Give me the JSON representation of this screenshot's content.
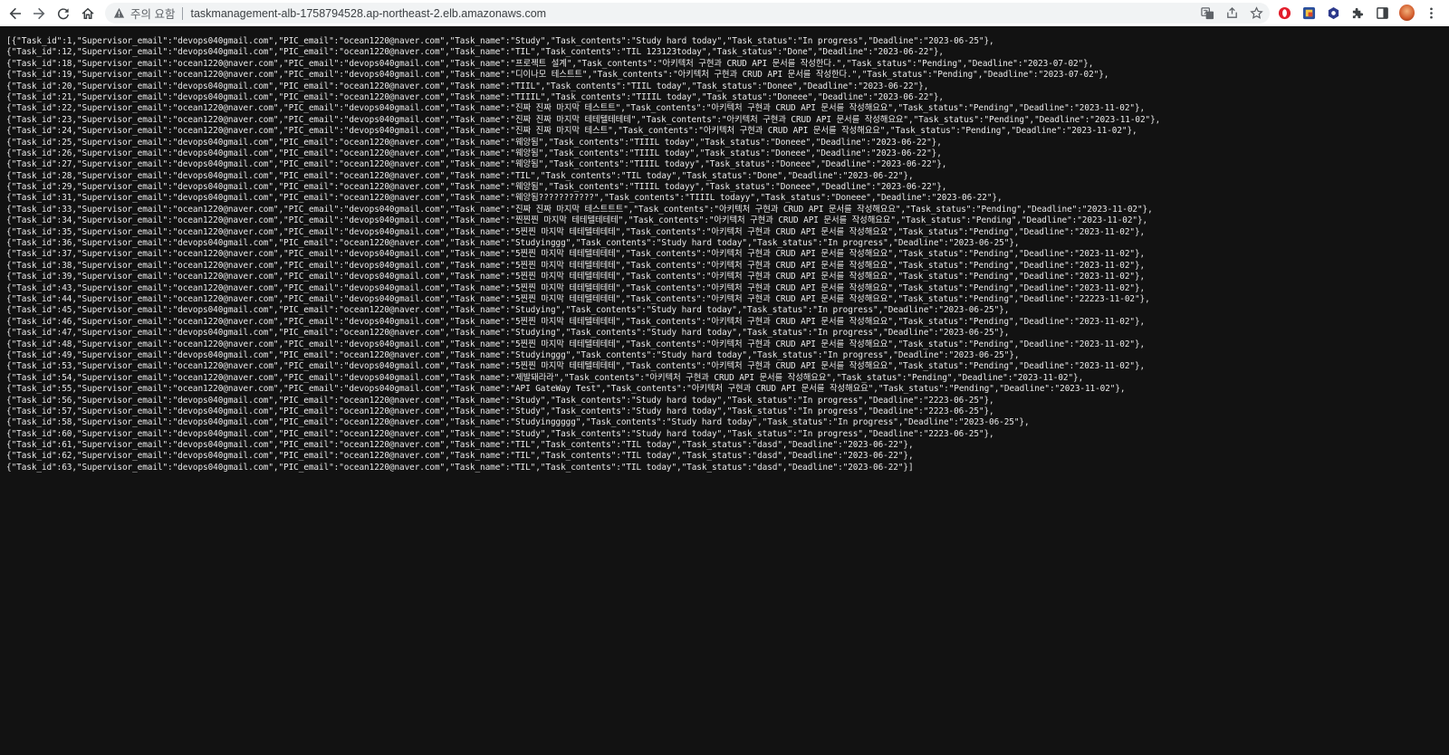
{
  "browser": {
    "security_label": "주의 요함",
    "url": "taskmanagement-alb-1758794528.ap-northeast-2.elb.amazonaws.com"
  },
  "response_lines": [
    "[{\"Task_id\":1,\"Supervisor_email\":\"devops040gmail.com\",\"PIC_email\":\"ocean1220@naver.com\",\"Task_name\":\"Study\",\"Task_contents\":\"Study hard today\",\"Task_status\":\"In progress\",\"Deadline\":\"2023-06-25\"},",
    "{\"Task_id\":12,\"Supervisor_email\":\"devops040gmail.com\",\"PIC_email\":\"ocean1220@naver.com\",\"Task_name\":\"TIL\",\"Task_contents\":\"TIL 123123today\",\"Task_status\":\"Done\",\"Deadline\":\"2023-06-22\"},",
    "{\"Task_id\":18,\"Supervisor_email\":\"ocean1220@naver.com\",\"PIC_email\":\"devops040gmail.com\",\"Task_name\":\"프로젝트 설계\",\"Task_contents\":\"아키텍처 구현과 CRUD API 문서를 작성한다.\",\"Task_status\":\"Pending\",\"Deadline\":\"2023-07-02\"},",
    "{\"Task_id\":19,\"Supervisor_email\":\"ocean1220@naver.com\",\"PIC_email\":\"devops040gmail.com\",\"Task_name\":\"디이나모 테스트트\",\"Task_contents\":\"아키텍처 구현과 CRUD API 문서를 작성한다.\",\"Task_status\":\"Pending\",\"Deadline\":\"2023-07-02\"},",
    "{\"Task_id\":20,\"Supervisor_email\":\"devops040gmail.com\",\"PIC_email\":\"ocean1220@naver.com\",\"Task_name\":\"TIIL\",\"Task_contents\":\"TIIL today\",\"Task_status\":\"Donee\",\"Deadline\":\"2023-06-22\"},",
    "{\"Task_id\":21,\"Supervisor_email\":\"devops040gmail.com\",\"PIC_email\":\"ocean1220@naver.com\",\"Task_name\":\"TIIIL\",\"Task_contents\":\"TIIIL today\",\"Task_status\":\"Doneee\",\"Deadline\":\"2023-06-22\"},",
    "{\"Task_id\":22,\"Supervisor_email\":\"ocean1220@naver.com\",\"PIC_email\":\"devops040gmail.com\",\"Task_name\":\"진짜 진짜 마지막 테스트트\",\"Task_contents\":\"아키텍처 구현과 CRUD API 문서를 작성해요요\",\"Task_status\":\"Pending\",\"Deadline\":\"2023-11-02\"},",
    "{\"Task_id\":23,\"Supervisor_email\":\"ocean1220@naver.com\",\"PIC_email\":\"devops040gmail.com\",\"Task_name\":\"진짜 진짜 마지막 테테텔테테테\",\"Task_contents\":\"아키텍처 구현과 CRUD API 문서를 작성해요요\",\"Task_status\":\"Pending\",\"Deadline\":\"2023-11-02\"},",
    "{\"Task_id\":24,\"Supervisor_email\":\"ocean1220@naver.com\",\"PIC_email\":\"devops040gmail.com\",\"Task_name\":\"진짜 진짜 마지막 테스트\",\"Task_contents\":\"아키텍처 구현과 CRUD API 문서를 작성해요요\",\"Task_status\":\"Pending\",\"Deadline\":\"2023-11-02\"},",
    "{\"Task_id\":25,\"Supervisor_email\":\"devops040gmail.com\",\"PIC_email\":\"ocean1220@naver.com\",\"Task_name\":\"웨앙됨\",\"Task_contents\":\"TIIIL today\",\"Task_status\":\"Doneee\",\"Deadline\":\"2023-06-22\"},",
    "{\"Task_id\":26,\"Supervisor_email\":\"devops040gmail.com\",\"PIC_email\":\"ocean1220@naver.com\",\"Task_name\":\"웨앙됨\",\"Task_contents\":\"TIIIL today\",\"Task_status\":\"Doneee\",\"Deadline\":\"2023-06-22\"},",
    "{\"Task_id\":27,\"Supervisor_email\":\"devops040gmail.com\",\"PIC_email\":\"ocean1220@naver.com\",\"Task_name\":\"웨앙됨\",\"Task_contents\":\"TIIIL todayy\",\"Task_status\":\"Doneee\",\"Deadline\":\"2023-06-22\"},",
    "{\"Task_id\":28,\"Supervisor_email\":\"devops040gmail.com\",\"PIC_email\":\"ocean1220@naver.com\",\"Task_name\":\"TIL\",\"Task_contents\":\"TIL today\",\"Task_status\":\"Done\",\"Deadline\":\"2023-06-22\"},",
    "{\"Task_id\":29,\"Supervisor_email\":\"devops040gmail.com\",\"PIC_email\":\"ocean1220@naver.com\",\"Task_name\":\"웨앙됨\",\"Task_contents\":\"TIIIL todayy\",\"Task_status\":\"Doneee\",\"Deadline\":\"2023-06-22\"},",
    "{\"Task_id\":31,\"Supervisor_email\":\"devops040gmail.com\",\"PIC_email\":\"ocean1220@naver.com\",\"Task_name\":\"웨앙됨???????????\",\"Task_contents\":\"TIIIL todayy\",\"Task_status\":\"Doneee\",\"Deadline\":\"2023-06-22\"},",
    "{\"Task_id\":33,\"Supervisor_email\":\"ocean1220@naver.com\",\"PIC_email\":\"devops040gmail.com\",\"Task_name\":\"진짜 진짜 마지막 테스트트트\",\"Task_contents\":\"아키텍처 구현과 CRUD API 문서를 작성해요요\",\"Task_status\":\"Pending\",\"Deadline\":\"2023-11-02\"},",
    "{\"Task_id\":34,\"Supervisor_email\":\"ocean1220@naver.com\",\"PIC_email\":\"devops040gmail.com\",\"Task_name\":\"찐찐찐 마지막 테테텔테테테\",\"Task_contents\":\"아키텍처 구현과 CRUD API 문서를 작성해요요\",\"Task_status\":\"Pending\",\"Deadline\":\"2023-11-02\"},",
    "{\"Task_id\":35,\"Supervisor_email\":\"ocean1220@naver.com\",\"PIC_email\":\"devops040gmail.com\",\"Task_name\":\"5찐찐 마지막 테테텔테테테\",\"Task_contents\":\"아키텍처 구현과 CRUD API 문서를 작성해요요\",\"Task_status\":\"Pending\",\"Deadline\":\"2023-11-02\"},",
    "{\"Task_id\":36,\"Supervisor_email\":\"devops040gmail.com\",\"PIC_email\":\"ocean1220@naver.com\",\"Task_name\":\"Studyinggg\",\"Task_contents\":\"Study hard today\",\"Task_status\":\"In progress\",\"Deadline\":\"2023-06-25\"},",
    "{\"Task_id\":37,\"Supervisor_email\":\"ocean1220@naver.com\",\"PIC_email\":\"devops040gmail.com\",\"Task_name\":\"5찐찐 마지막 테테텔테테테\",\"Task_contents\":\"아키텍처 구현과 CRUD API 문서를 작성해요요\",\"Task_status\":\"Pending\",\"Deadline\":\"2023-11-02\"},",
    "{\"Task_id\":38,\"Supervisor_email\":\"ocean1220@naver.com\",\"PIC_email\":\"devops040gmail.com\",\"Task_name\":\"5찐찐 마지막 테테텔테테테\",\"Task_contents\":\"아키텍처 구현과 CRUD API 문서를 작성해요요\",\"Task_status\":\"Pending\",\"Deadline\":\"2023-11-02\"},",
    "{\"Task_id\":39,\"Supervisor_email\":\"ocean1220@naver.com\",\"PIC_email\":\"devops040gmail.com\",\"Task_name\":\"5찐찐 마지막 테테텔테테테\",\"Task_contents\":\"아키텍처 구현과 CRUD API 문서를 작성해요요\",\"Task_status\":\"Pending\",\"Deadline\":\"2023-11-02\"},",
    "{\"Task_id\":43,\"Supervisor_email\":\"ocean1220@naver.com\",\"PIC_email\":\"devops040gmail.com\",\"Task_name\":\"5찐찐 마지막 테테텔테테테\",\"Task_contents\":\"아키텍처 구현과 CRUD API 문서를 작성해요요\",\"Task_status\":\"Pending\",\"Deadline\":\"2023-11-02\"},",
    "{\"Task_id\":44,\"Supervisor_email\":\"ocean1220@naver.com\",\"PIC_email\":\"devops040gmail.com\",\"Task_name\":\"5찐찐 마지막 테테텔테테테\",\"Task_contents\":\"아키텍처 구현과 CRUD API 문서를 작성해요요\",\"Task_status\":\"Pending\",\"Deadline\":\"22223-11-02\"},",
    "{\"Task_id\":45,\"Supervisor_email\":\"devops040gmail.com\",\"PIC_email\":\"ocean1220@naver.com\",\"Task_name\":\"Studying\",\"Task_contents\":\"Study hard today\",\"Task_status\":\"In progress\",\"Deadline\":\"2023-06-25\"},",
    "{\"Task_id\":46,\"Supervisor_email\":\"ocean1220@naver.com\",\"PIC_email\":\"devops040gmail.com\",\"Task_name\":\"5찐찐 마지막 테테텔테테테\",\"Task_contents\":\"아키텍처 구현과 CRUD API 문서를 작성해요요\",\"Task_status\":\"Pending\",\"Deadline\":\"2023-11-02\"},",
    "{\"Task_id\":47,\"Supervisor_email\":\"devops040gmail.com\",\"PIC_email\":\"ocean1220@naver.com\",\"Task_name\":\"Studying\",\"Task_contents\":\"Study hard today\",\"Task_status\":\"In progress\",\"Deadline\":\"2023-06-25\"},",
    "{\"Task_id\":48,\"Supervisor_email\":\"ocean1220@naver.com\",\"PIC_email\":\"devops040gmail.com\",\"Task_name\":\"5찐찐 마지막 테테텔테테테\",\"Task_contents\":\"아키텍처 구현과 CRUD API 문서를 작성해요요\",\"Task_status\":\"Pending\",\"Deadline\":\"2023-11-02\"},",
    "{\"Task_id\":49,\"Supervisor_email\":\"devops040gmail.com\",\"PIC_email\":\"ocean1220@naver.com\",\"Task_name\":\"Studyinggg\",\"Task_contents\":\"Study hard today\",\"Task_status\":\"In progress\",\"Deadline\":\"2023-06-25\"},",
    "{\"Task_id\":53,\"Supervisor_email\":\"ocean1220@naver.com\",\"PIC_email\":\"devops040gmail.com\",\"Task_name\":\"5찐찐 마지막 테테텔테테테\",\"Task_contents\":\"아키텍처 구현과 CRUD API 문서를 작성해요요\",\"Task_status\":\"Pending\",\"Deadline\":\"2023-11-02\"},",
    "{\"Task_id\":54,\"Supervisor_email\":\"ocean1220@naver.com\",\"PIC_email\":\"devops040gmail.com\",\"Task_name\":\"제발돼라라\",\"Task_contents\":\"아키텍처 구현과 CRUD API 문서를 작성해요요\",\"Task_status\":\"Pending\",\"Deadline\":\"2023-11-02\"},",
    "{\"Task_id\":55,\"Supervisor_email\":\"ocean1220@naver.com\",\"PIC_email\":\"devops040gmail.com\",\"Task_name\":\"API GateWay Test\",\"Task_contents\":\"아키텍처 구현과 CRUD API 문서를 작성해요요\",\"Task_status\":\"Pending\",\"Deadline\":\"2023-11-02\"},",
    "{\"Task_id\":56,\"Supervisor_email\":\"devops040gmail.com\",\"PIC_email\":\"ocean1220@naver.com\",\"Task_name\":\"Study\",\"Task_contents\":\"Study hard today\",\"Task_status\":\"In progress\",\"Deadline\":\"2223-06-25\"},",
    "{\"Task_id\":57,\"Supervisor_email\":\"devops040gmail.com\",\"PIC_email\":\"ocean1220@naver.com\",\"Task_name\":\"Study\",\"Task_contents\":\"Study hard today\",\"Task_status\":\"In progress\",\"Deadline\":\"2223-06-25\"},",
    "{\"Task_id\":58,\"Supervisor_email\":\"devops040gmail.com\",\"PIC_email\":\"ocean1220@naver.com\",\"Task_name\":\"Studyinggggg\",\"Task_contents\":\"Study hard today\",\"Task_status\":\"In progress\",\"Deadline\":\"2023-06-25\"},",
    "{\"Task_id\":60,\"Supervisor_email\":\"devops040gmail.com\",\"PIC_email\":\"ocean1220@naver.com\",\"Task_name\":\"Study\",\"Task_contents\":\"Study hard today\",\"Task_status\":\"In progress\",\"Deadline\":\"2223-06-25\"},",
    "{\"Task_id\":61,\"Supervisor_email\":\"devops040gmail.com\",\"PIC_email\":\"ocean1220@naver.com\",\"Task_name\":\"TIL\",\"Task_contents\":\"TIL today\",\"Task_status\":\"dasd\",\"Deadline\":\"2023-06-22\"},",
    "{\"Task_id\":62,\"Supervisor_email\":\"devops040gmail.com\",\"PIC_email\":\"ocean1220@naver.com\",\"Task_name\":\"TIL\",\"Task_contents\":\"TIL today\",\"Task_status\":\"dasd\",\"Deadline\":\"2023-06-22\"},",
    "{\"Task_id\":63,\"Supervisor_email\":\"devops040gmail.com\",\"PIC_email\":\"ocean1220@naver.com\",\"Task_name\":\"TIL\",\"Task_contents\":\"TIL today\",\"Task_status\":\"dasd\",\"Deadline\":\"2023-06-22\"}]"
  ],
  "colors": {
    "page_background": "#121212",
    "text": "#eaeaea",
    "toolbar_background": "#ffffff",
    "omnibox_background": "#f1f3f4"
  }
}
